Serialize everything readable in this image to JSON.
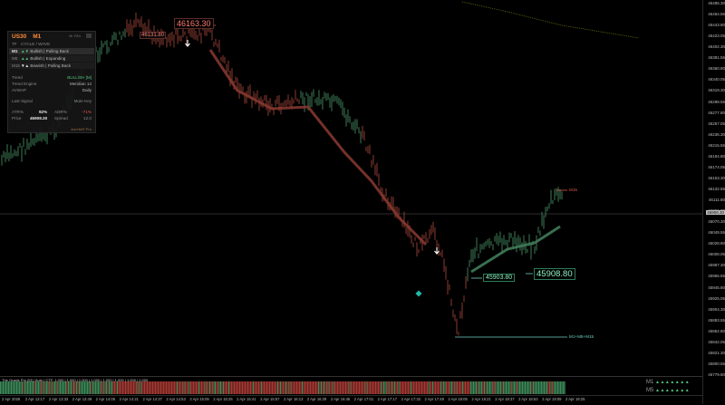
{
  "panel": {
    "symbol": "US30",
    "timeframe": "M1",
    "header_mini": "Mr. PA's",
    "cols": {
      "tf": "TF",
      "cycle": "CYCLE / WAVE"
    },
    "rows": [
      {
        "tf": "M1",
        "arrows": "▲▼",
        "text": "Bullish | Pulling Back",
        "tone": "mixed"
      },
      {
        "tf": "M5",
        "arrows": "▲▲",
        "text": "Bullish | Expanding",
        "tone": "green"
      },
      {
        "tf": "M15",
        "arrows": "▼▲",
        "text": "Bearish | Pulling Back",
        "tone": "mixed"
      }
    ],
    "trend_label": "Trend",
    "trend_value": "BULLISH [M]",
    "engine_label": "Trend Engine",
    "engine_value": "Meridian 14",
    "avwap_label": "AVWAP",
    "avwap_value": "Daily",
    "signal_label": "Last Signal",
    "signal_value": "Mute Key",
    "atr_label": "ATR%",
    "atr_value": "92%",
    "adr_label": "ADR%",
    "adr_value": "-71%",
    "price_label": "Price",
    "price_value": "45908.30",
    "spread_label": "Spread",
    "spread_value": "12.0",
    "footer": "Aurelia® Pro"
  },
  "labels": {
    "high_price": "46163.30",
    "high_small": "46131.80",
    "low_a": "45903.80",
    "low_b": "45908.80",
    "m15_tag": "M15",
    "m1m5_tag": "M1+M5+M15"
  },
  "price_axis": [
    "46485.30",
    "46464.55",
    "46443.80",
    "46423.05",
    "46402.30",
    "46381.55",
    "46360.80",
    "46340.05",
    "46319.30",
    "46298.55",
    "46277.80",
    "46257.05",
    "46236.30",
    "46215.55",
    "46194.80",
    "46174.05",
    "46153.30",
    "46132.55",
    "46111.80",
    "46091.05",
    "46070.30",
    "46049.55",
    "46028.80",
    "46008.05",
    "45987.30",
    "45966.55",
    "45945.80",
    "45925.05",
    "45904.30",
    "45883.55",
    "45862.80",
    "45842.05",
    "45821.30",
    "45800.55",
    "45779.80"
  ],
  "price_highlight": "45908.30",
  "sub_title": "The Oracle Pro [M] | Auto | CTF: 1.000 | 1.000 | 1.000 | 1.000 | 1.000 | 1.000 | 1.000 | 1.000",
  "sub_timeframes": [
    {
      "tf": "M1",
      "tri": "▲▲▲▲▲▲▲"
    },
    {
      "tf": "M5",
      "tri": "▲▲▲▲▲▲▲"
    }
  ],
  "time_axis": [
    "2 Apr 2026",
    "2 Apr 13:17",
    "2 Apr 13:33",
    "2 Apr 13:49",
    "2 Apr 14:05",
    "2 Apr 14:21",
    "2 Apr 14:37",
    "2 Apr 14:53",
    "2 Apr 15:09",
    "2 Apr 15:25",
    "2 Apr 15:41",
    "2 Apr 15:57",
    "2 Apr 16:13",
    "2 Apr 16:29",
    "2 Apr 16:45",
    "2 Apr 17:01",
    "2 Apr 17:17",
    "2 Apr 17:33",
    "2 Apr 17:49",
    "2 Apr 18:05",
    "2 Apr 18:21",
    "2 Apr 18:37",
    "2 Apr 18:53",
    "2 Apr 19:09",
    "2 Apr 19:25"
  ],
  "colors": {
    "bull": "#3f7a58",
    "bear": "#8a3a30",
    "accent": "#ff8c3a",
    "teal": "#22b8a8"
  }
}
